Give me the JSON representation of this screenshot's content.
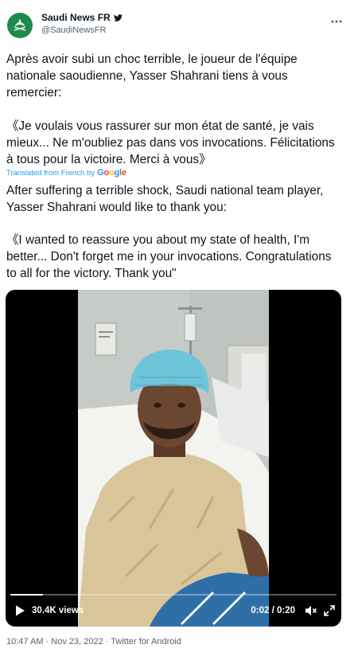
{
  "author": {
    "name": "Saudi News FR",
    "handle": "@SaudiNewsFR",
    "avatar_icon": "saudi-emblem-icon",
    "verified_icon": "twitter-bird-icon"
  },
  "more_icon": "more-icon",
  "tweet": {
    "french_intro": "Après avoir subi un choc terrible, le joueur de l'équipe nationale saoudienne, Yasser Shahrani tiens à vous remercier:",
    "french_quote": "《Je voulais vous rassurer sur mon état de santé, je vais mieux... Ne m'oubliez pas dans vos invocations. Félicitations à tous pour la victoire. Merci à vous》",
    "translated_label": "Translated from French by",
    "translator": {
      "g1": "G",
      "g2": "o",
      "g3": "o",
      "g4": "g",
      "g5": "l",
      "g6": "e"
    },
    "english_intro": "After suffering a terrible shock, Saudi national team player, Yasser Shahrani would like to thank you:",
    "english_quote": "《I wanted to reassure you about my state of health, I'm better... Don't forget me in your invocations. Congratulations to all for the victory. Thank you\""
  },
  "video": {
    "views": "30.4K views",
    "time": "0:02 / 0:20",
    "progress": 0.1,
    "play_icon": "play-icon",
    "mute_icon": "mute-icon",
    "expand_icon": "expand-icon"
  },
  "meta": {
    "timestamp_source": "10:47 AM · Nov 23, 2022 · Twitter for Android"
  },
  "colors": {
    "link": "#1d9bf0",
    "secondary_text": "#536471",
    "avatar_bg": "#1f8a4c"
  }
}
